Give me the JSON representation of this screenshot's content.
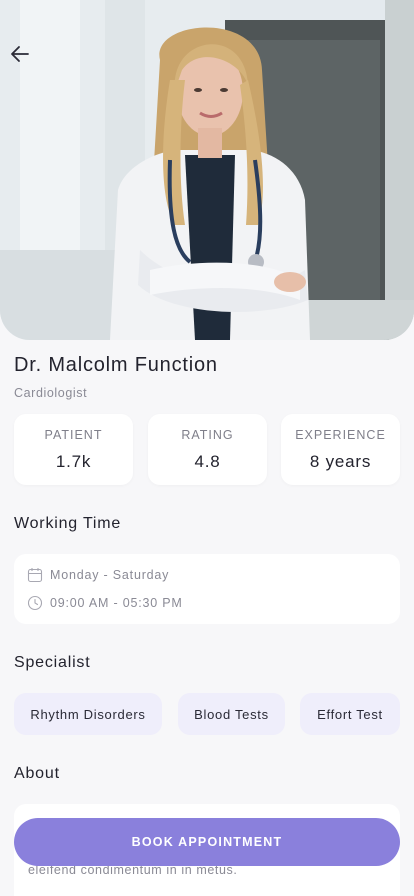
{
  "doctor": {
    "name": "Dr. Malcolm Function",
    "specialty": "Cardiologist"
  },
  "stats": [
    {
      "label": "PATIENT",
      "value": "1.7k"
    },
    {
      "label": "RATING",
      "value": "4.8"
    },
    {
      "label": "EXPERIENCE",
      "value": "8 years"
    }
  ],
  "working_time": {
    "title": "Working Time",
    "days": "Monday - Saturday",
    "hours": "09:00 AM - 05:30 PM"
  },
  "specialist": {
    "title": "Specialist",
    "items": [
      "Rhythm Disorders",
      "Blood Tests",
      "Effort Test"
    ]
  },
  "about": {
    "title": "About",
    "text": "eleifend condimentum in in metus."
  },
  "actions": {
    "book_label": "BOOK APPOINTMENT"
  },
  "colors": {
    "accent": "#8a80dc",
    "chip_bg": "#efeefb",
    "page_bg": "#f7f7f9"
  },
  "icons": {
    "back": "arrow-left-icon",
    "calendar": "calendar-icon",
    "clock": "clock-icon"
  }
}
